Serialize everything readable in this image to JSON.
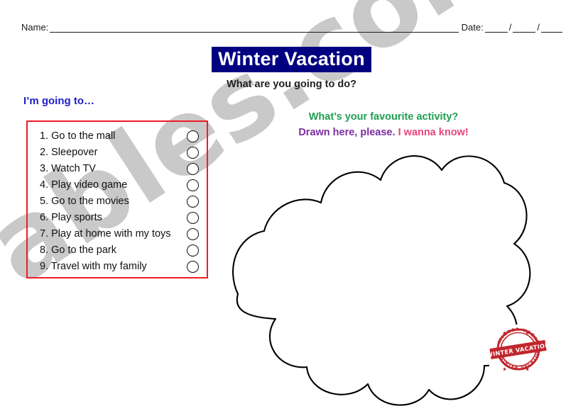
{
  "header": {
    "name_label": "Name:",
    "date_label": "Date:",
    "date_separator": "/"
  },
  "title": {
    "main": "Winter Vacation",
    "subtitle": "What are you going to do?",
    "highlight_color": "#000080",
    "title_text_color": "#ffffff"
  },
  "left_panel": {
    "heading": "I’m going to…",
    "heading_color": "#1f1fc8",
    "box_border_color": "#ee1c25",
    "items": [
      {
        "number": "1.",
        "label": "Go to the mall"
      },
      {
        "number": "2.",
        "label": "Sleepover"
      },
      {
        "number": "3.",
        "label": "Watch TV"
      },
      {
        "number": "4.",
        "label": "Play video game"
      },
      {
        "number": "5.",
        "label": "Go to the movies"
      },
      {
        "number": "6.",
        "label": "Play sports"
      },
      {
        "number": "7.",
        "label": "Play at home with my toys"
      },
      {
        "number": "8.",
        "label": "Go to the park"
      },
      {
        "number": "9.",
        "label": "Travel with my family"
      }
    ]
  },
  "right_panel": {
    "prompt_line_1": "What’s your favourite activity?",
    "prompt_line_1_color": "#1f9e52",
    "prompt_line_2_part_1": "Drawn here, please.",
    "prompt_line_2_part_1_color": "#7b2fa0",
    "prompt_line_2_part_2": "I wanna know!",
    "prompt_line_2_part_2_color": "#e8457e",
    "drawing_area": "cloud-outline"
  },
  "stamp": {
    "text": "WINTER VACATION",
    "arc_top_text": "WINTER VACATION",
    "arc_bottom_text": "WINTER VACATION",
    "color": "#c1272d"
  },
  "watermark": {
    "text": "ables.com",
    "color": "#c9c9c9"
  }
}
